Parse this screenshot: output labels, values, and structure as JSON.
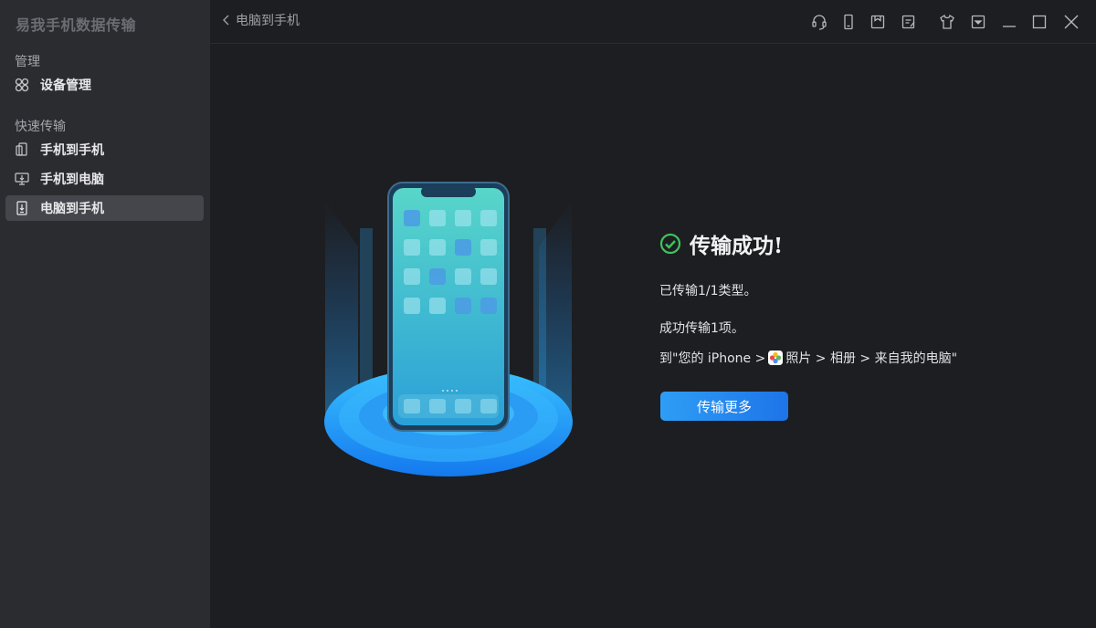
{
  "app": {
    "title": "易我手机数据传输"
  },
  "sidebar": {
    "section_manage": "管理",
    "device_manage": "设备管理",
    "section_quick": "快速传输",
    "items": [
      {
        "label": "手机到手机",
        "icon": "phone-to-phone-icon",
        "active": false
      },
      {
        "label": "手机到电脑",
        "icon": "phone-to-pc-icon",
        "active": false
      },
      {
        "label": "电脑到手机",
        "icon": "pc-to-phone-icon",
        "active": true
      }
    ]
  },
  "topbar": {
    "back_label": "电脑到手机",
    "icons": [
      "headset-icon",
      "phone-icon",
      "bookmark-icon",
      "notes-icon",
      "tshirt-icon",
      "dropdown-menu-icon",
      "minimize-icon",
      "maximize-icon",
      "close-icon"
    ]
  },
  "result": {
    "title": "传输成功!",
    "line1": "已传输1/1类型。",
    "line2": "成功传输1项。",
    "path_prefix": "到\"您的 iPhone > ",
    "path_photos": "照片",
    "path_suffix": " > 相册 > 来自我的电脑\"",
    "button": "传输更多"
  },
  "colors": {
    "sidebar_bg": "#2b2c30",
    "main_bg": "#1d1e21",
    "accent": "#1d74e8",
    "success": "#3fc35d"
  }
}
